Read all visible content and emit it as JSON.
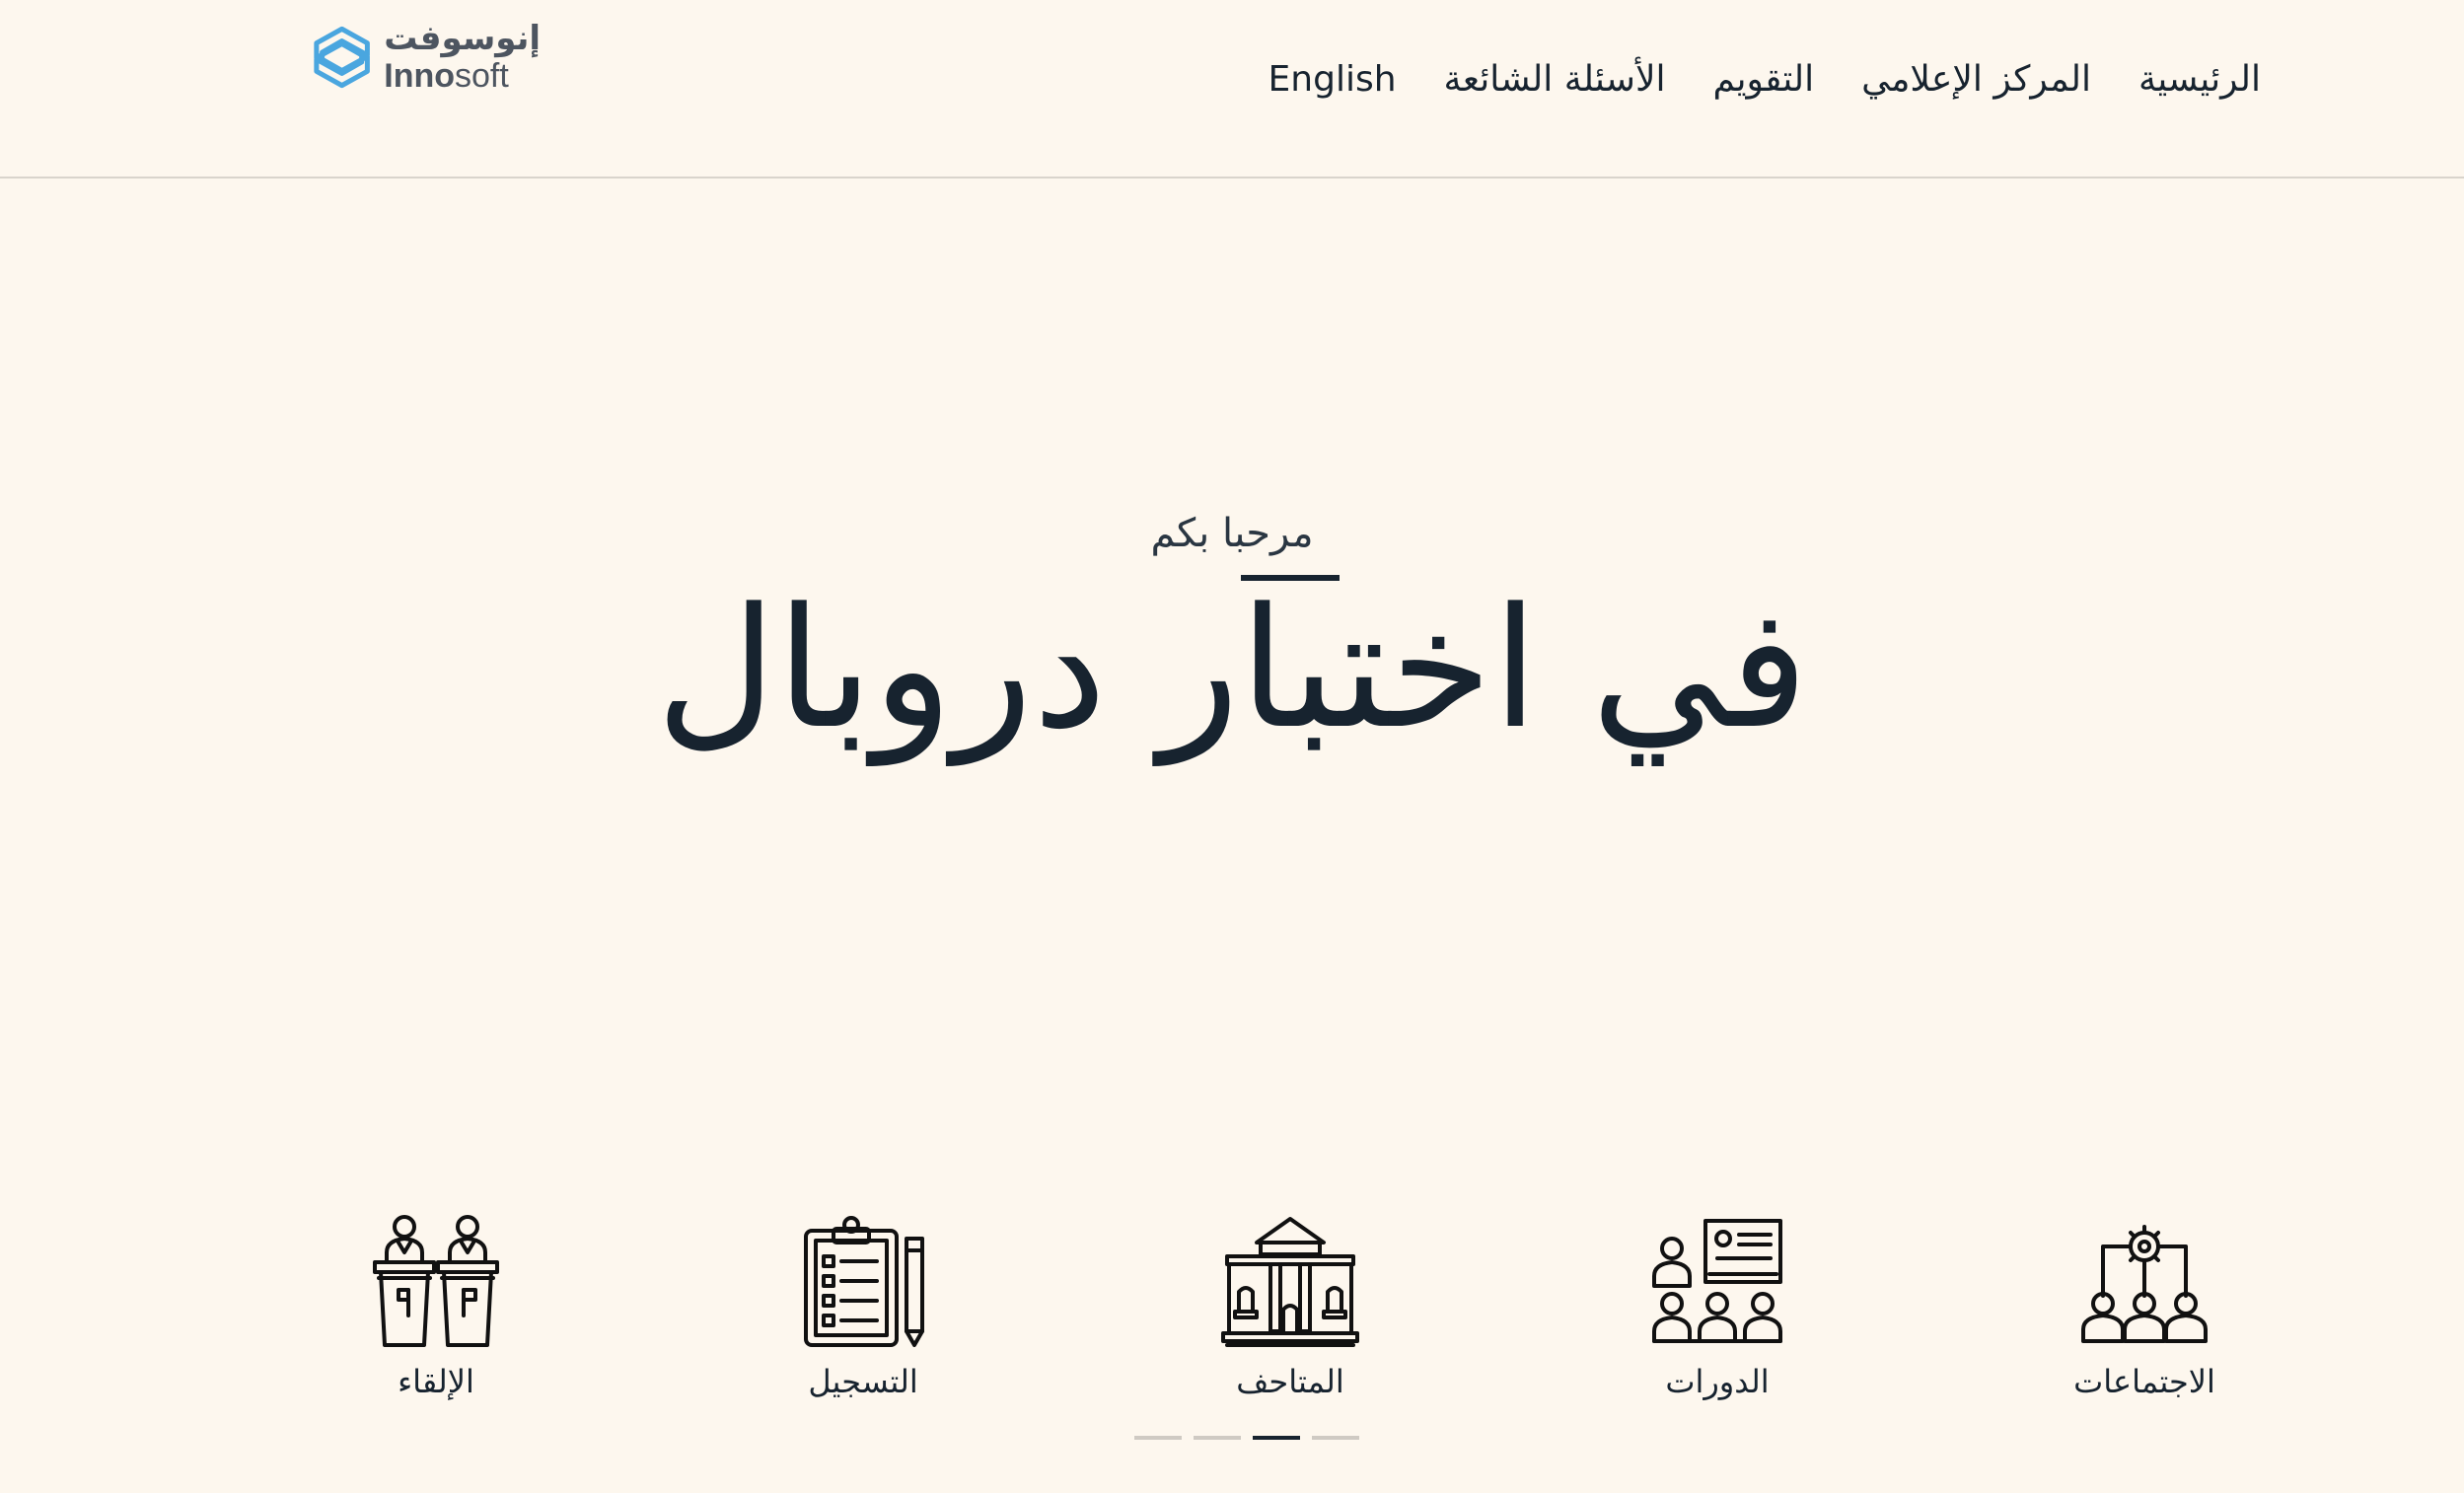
{
  "header": {
    "logo_ar": "إنوسوفت",
    "logo_en_bold": "Inno",
    "logo_en_rest": "soft",
    "nav": [
      {
        "label": "الرئيسية"
      },
      {
        "label": "المركز الإعلامي"
      },
      {
        "label": "التقويم"
      },
      {
        "label": "الأسئلة الشائعة"
      },
      {
        "label": "English"
      }
    ]
  },
  "hero": {
    "subtitle": "مرحبا بكم",
    "title": "في اختبار دروبال"
  },
  "features": [
    {
      "label": "الاجتماعات",
      "icon": "meeting-gear-icon"
    },
    {
      "label": "الدورات",
      "icon": "training-course-icon"
    },
    {
      "label": "المتاحف",
      "icon": "museum-icon"
    },
    {
      "label": "التسجيل",
      "icon": "clipboard-registration-icon"
    },
    {
      "label": "الإلقاء",
      "icon": "podium-speakers-icon"
    }
  ],
  "carousel": {
    "pages": 4,
    "active_index": 2
  },
  "colors": {
    "background": "#fdf7ee",
    "text": "#17232f",
    "logo_blue": "#4aa6df"
  }
}
